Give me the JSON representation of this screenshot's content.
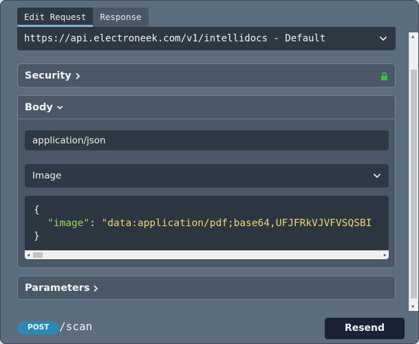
{
  "tabs": [
    {
      "label": "Edit Request",
      "active": true
    },
    {
      "label": "Response",
      "active": false
    }
  ],
  "server": {
    "value": "https://api.electroneek.com/v1/intellidocs - Default"
  },
  "security": {
    "title": "Security",
    "lock_color": "#3ec43e"
  },
  "body": {
    "title": "Body",
    "content_type": "application/json",
    "example": "Image",
    "code": {
      "open": "{",
      "key": "\"image\"",
      "sep": ": ",
      "value": "\"data:application/pdf;base64,UFJFRkVJVFVSQSBI",
      "close": "}"
    }
  },
  "parameters": {
    "title": "Parameters"
  },
  "footer": {
    "method": "POST",
    "path": "/scan",
    "send_label": "Resend"
  }
}
